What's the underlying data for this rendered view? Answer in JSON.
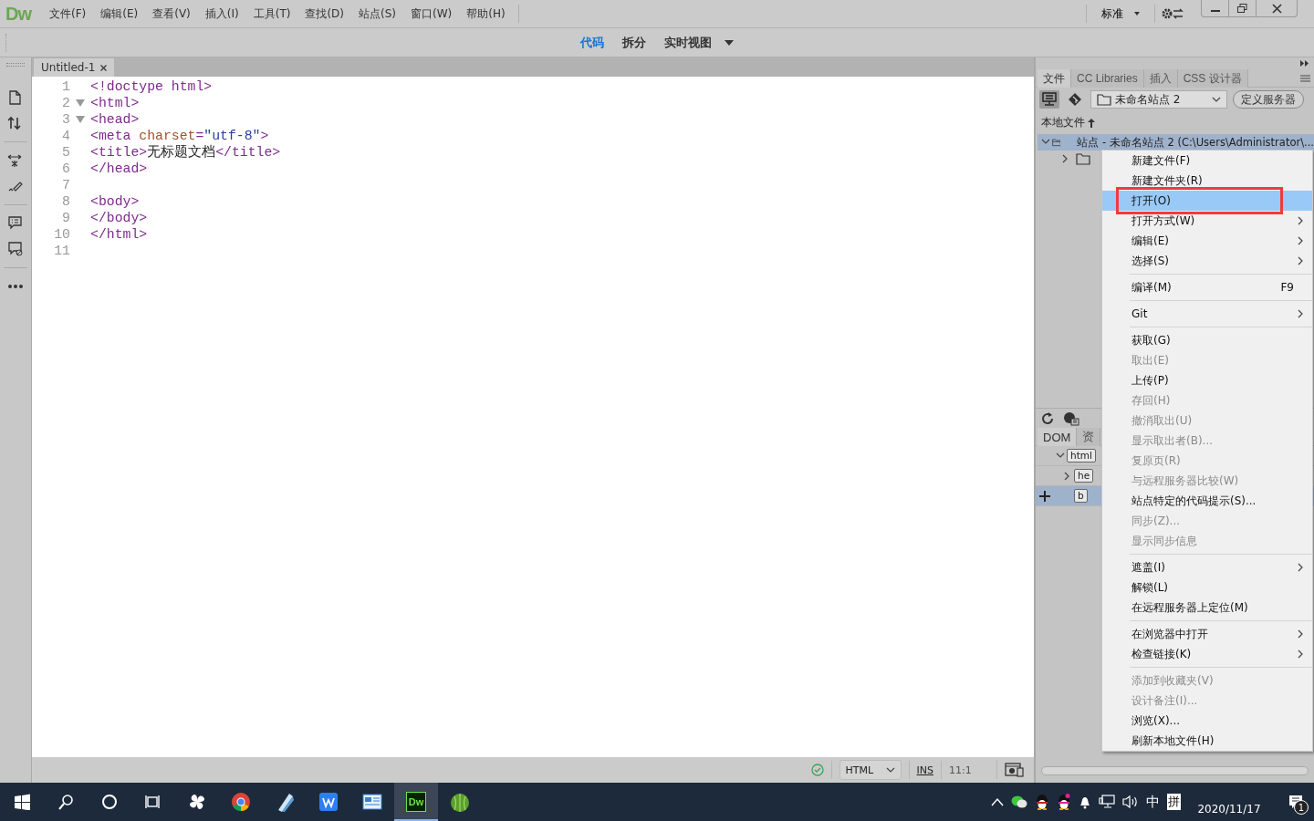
{
  "app": {
    "logo": "Dw",
    "menu": [
      "文件(F)",
      "编辑(E)",
      "查看(V)",
      "插入(I)",
      "工具(T)",
      "查找(D)",
      "站点(S)",
      "窗口(W)",
      "帮助(H)"
    ],
    "workspace": "标准"
  },
  "view_modes": [
    {
      "label": "代码",
      "selected": true
    },
    {
      "label": "拆分",
      "selected": false
    },
    {
      "label": "实时视图",
      "selected": false,
      "dropdown": true
    }
  ],
  "document_tabs": [
    {
      "label": "Untitled-1",
      "selected": true
    }
  ],
  "code_lines": [
    {
      "number": "1",
      "foldable": false,
      "tokens": [
        {
          "kind": "tag",
          "text": "<!doctype html>"
        }
      ]
    },
    {
      "number": "2",
      "foldable": true,
      "tokens": [
        {
          "kind": "tag",
          "text": "<html>"
        }
      ]
    },
    {
      "number": "3",
      "foldable": true,
      "tokens": [
        {
          "kind": "tag",
          "text": "<head>"
        }
      ]
    },
    {
      "number": "4",
      "foldable": false,
      "tokens": [
        {
          "kind": "tag",
          "text": "<meta "
        },
        {
          "kind": "attr",
          "text": "charset"
        },
        {
          "kind": "tag",
          "text": "="
        },
        {
          "kind": "value",
          "text": "\"utf-8\""
        },
        {
          "kind": "tag",
          "text": ">"
        }
      ]
    },
    {
      "number": "5",
      "foldable": false,
      "tokens": [
        {
          "kind": "tag",
          "text": "<title>"
        },
        {
          "kind": "text",
          "text": "无标题文档"
        },
        {
          "kind": "tag",
          "text": "</title>"
        }
      ]
    },
    {
      "number": "6",
      "foldable": false,
      "tokens": [
        {
          "kind": "tag",
          "text": "</head>"
        }
      ]
    },
    {
      "number": "7",
      "foldable": false
    },
    {
      "number": "8",
      "foldable": false,
      "tokens": [
        {
          "kind": "tag",
          "text": "<body>"
        }
      ]
    },
    {
      "number": "9",
      "foldable": false,
      "tokens": [
        {
          "kind": "tag",
          "text": "</body>"
        }
      ]
    },
    {
      "number": "10",
      "foldable": false,
      "tokens": [
        {
          "kind": "tag",
          "text": "</html>"
        }
      ]
    },
    {
      "number": "11",
      "foldable": false
    }
  ],
  "status_bar": {
    "valid": true,
    "language": "HTML",
    "mode": "INS",
    "position": "11:1"
  },
  "files_panel": {
    "tabs": [
      {
        "label": "文件",
        "selected": true
      },
      {
        "label": "CC Libraries",
        "selected": false
      },
      {
        "label": "插入",
        "selected": false
      },
      {
        "label": "CSS 设计器",
        "selected": false
      }
    ],
    "site": "未命名站点 2",
    "define_server": "定义服务器",
    "view": "本地文件",
    "tree": [
      {
        "label": "站点 - 未命名站点 2 (C:\\Users\\Administrator\\...",
        "expanded": true,
        "selected": true,
        "children": [
          {
            "expanded": false,
            "selected": false
          }
        ]
      }
    ]
  },
  "dom_panel": {
    "tabs": [
      {
        "label": "DOM",
        "selected": true
      },
      {
        "label": "资",
        "selected": false
      }
    ],
    "tree": [
      {
        "tag": "html",
        "expanded": true,
        "selected": false,
        "children": [
          {
            "tag": "he",
            "expanded": false,
            "selected": false
          },
          {
            "tag": "b",
            "selected": true
          }
        ]
      }
    ]
  },
  "context_menu": [
    {
      "kind": "item",
      "label": "新建文件(F)",
      "submenu": false,
      "disabled": false,
      "selected": false,
      "outlined": false
    },
    {
      "kind": "item",
      "label": "新建文件夹(R)",
      "submenu": false,
      "disabled": false,
      "selected": false,
      "outlined": false
    },
    {
      "kind": "item",
      "label": "打开(O)",
      "submenu": false,
      "disabled": false,
      "selected": true,
      "outlined": true
    },
    {
      "kind": "item",
      "label": "打开方式(W)",
      "submenu": true,
      "disabled": false,
      "selected": false,
      "outlined": false
    },
    {
      "kind": "item",
      "label": "编辑(E)",
      "submenu": true,
      "disabled": false,
      "selected": false,
      "outlined": false
    },
    {
      "kind": "item",
      "label": "选择(S)",
      "submenu": true,
      "disabled": false,
      "selected": false,
      "outlined": false
    },
    {
      "kind": "separator"
    },
    {
      "kind": "item",
      "label": "编译(M)",
      "shortcut": "F9",
      "submenu": false,
      "disabled": false,
      "selected": false,
      "outlined": false
    },
    {
      "kind": "separator"
    },
    {
      "kind": "item",
      "label": "Git",
      "submenu": true,
      "disabled": false,
      "selected": false,
      "outlined": false
    },
    {
      "kind": "separator"
    },
    {
      "kind": "item",
      "label": "获取(G)",
      "submenu": false,
      "disabled": false,
      "selected": false,
      "outlined": false
    },
    {
      "kind": "item",
      "label": "取出(E)",
      "submenu": false,
      "disabled": true,
      "selected": false,
      "outlined": false
    },
    {
      "kind": "item",
      "label": "上传(P)",
      "submenu": false,
      "disabled": false,
      "selected": false,
      "outlined": false
    },
    {
      "kind": "item",
      "label": "存回(H)",
      "submenu": false,
      "disabled": true,
      "selected": false,
      "outlined": false
    },
    {
      "kind": "item",
      "label": "撤消取出(U)",
      "submenu": false,
      "disabled": true,
      "selected": false,
      "outlined": false
    },
    {
      "kind": "item",
      "label": "显示取出者(B)...",
      "submenu": false,
      "disabled": true,
      "selected": false,
      "outlined": false
    },
    {
      "kind": "item",
      "label": "复原页(R)",
      "submenu": false,
      "disabled": true,
      "selected": false,
      "outlined": false
    },
    {
      "kind": "item",
      "label": "与远程服务器比较(W)",
      "submenu": false,
      "disabled": true,
      "selected": false,
      "outlined": false
    },
    {
      "kind": "item",
      "label": "站点特定的代码提示(S)...",
      "submenu": false,
      "disabled": false,
      "selected": false,
      "outlined": false
    },
    {
      "kind": "item",
      "label": "同步(Z)...",
      "submenu": false,
      "disabled": true,
      "selected": false,
      "outlined": false
    },
    {
      "kind": "item",
      "label": "显示同步信息",
      "submenu": false,
      "disabled": true,
      "selected": false,
      "outlined": false
    },
    {
      "kind": "separator"
    },
    {
      "kind": "item",
      "label": "遮盖(I)",
      "submenu": true,
      "disabled": false,
      "selected": false,
      "outlined": false
    },
    {
      "kind": "item",
      "label": "解锁(L)",
      "submenu": false,
      "disabled": false,
      "selected": false,
      "outlined": false
    },
    {
      "kind": "item",
      "label": "在远程服务器上定位(M)",
      "submenu": false,
      "disabled": false,
      "selected": false,
      "outlined": false
    },
    {
      "kind": "separator"
    },
    {
      "kind": "item",
      "label": "在浏览器中打开",
      "submenu": true,
      "disabled": false,
      "selected": false,
      "outlined": false
    },
    {
      "kind": "item",
      "label": "检查链接(K)",
      "submenu": true,
      "disabled": false,
      "selected": false,
      "outlined": false
    },
    {
      "kind": "separator"
    },
    {
      "kind": "item",
      "label": "添加到收藏夹(V)",
      "submenu": false,
      "disabled": true,
      "selected": false,
      "outlined": false
    },
    {
      "kind": "item",
      "label": "设计备注(I)...",
      "submenu": false,
      "disabled": true,
      "selected": false,
      "outlined": false
    },
    {
      "kind": "item",
      "label": "浏览(X)...",
      "submenu": false,
      "disabled": false,
      "selected": false,
      "outlined": false
    },
    {
      "kind": "item",
      "label": "刷新本地文件(H)",
      "submenu": false,
      "disabled": false,
      "selected": false,
      "outlined": false
    }
  ],
  "taskbar": {
    "apps": [
      {
        "kind": "pinwheel",
        "active": false
      },
      {
        "kind": "chrome",
        "active": false
      },
      {
        "kind": "pen",
        "active": false
      },
      {
        "kind": "writer",
        "active": false
      },
      {
        "kind": "panel",
        "active": false
      },
      {
        "kind": "dw",
        "label": "Dw",
        "active": true
      },
      {
        "kind": "melon",
        "active": false
      }
    ],
    "input_mode": "中",
    "ime": "拼",
    "date": "2020/11/17",
    "notifications": "1"
  }
}
